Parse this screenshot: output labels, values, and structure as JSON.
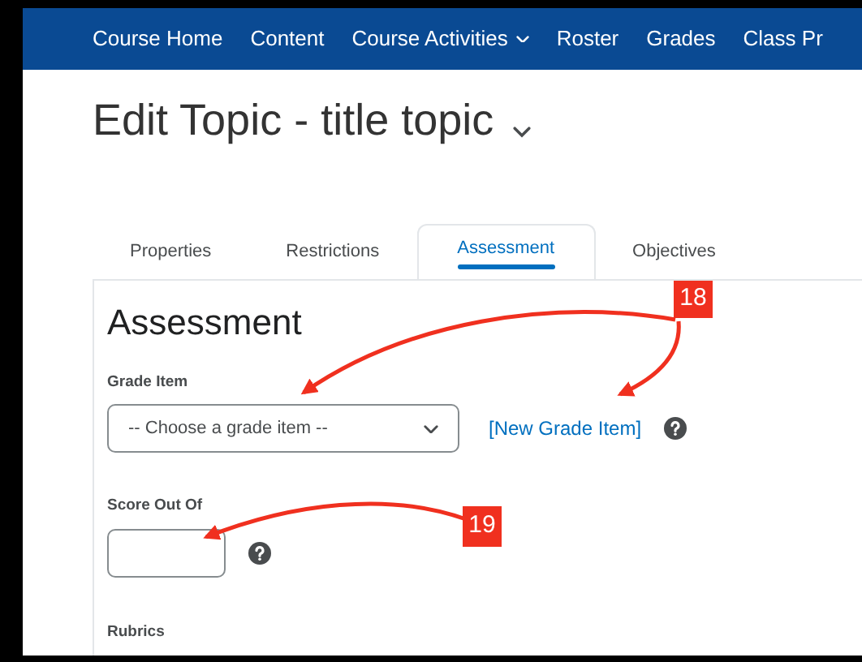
{
  "nav": [
    {
      "label": "Course Home",
      "has_menu": false
    },
    {
      "label": "Content",
      "has_menu": false
    },
    {
      "label": "Course Activities",
      "has_menu": true
    },
    {
      "label": "Roster",
      "has_menu": false
    },
    {
      "label": "Grades",
      "has_menu": false
    },
    {
      "label": "Class Pr",
      "has_menu": false
    }
  ],
  "page_title": "Edit Topic - title topic",
  "tabs": [
    {
      "label": "Properties",
      "selected": false
    },
    {
      "label": "Restrictions",
      "selected": false
    },
    {
      "label": "Assessment",
      "selected": true
    },
    {
      "label": "Objectives",
      "selected": false
    }
  ],
  "section_title": "Assessment",
  "grade_item": {
    "label": "Grade Item",
    "value": "-- Choose a grade item --",
    "link": "[New Grade Item]"
  },
  "score": {
    "label": "Score Out Of"
  },
  "rubrics": {
    "label": "Rubrics"
  },
  "callouts": [
    {
      "number": "18"
    },
    {
      "number": "19"
    }
  ]
}
